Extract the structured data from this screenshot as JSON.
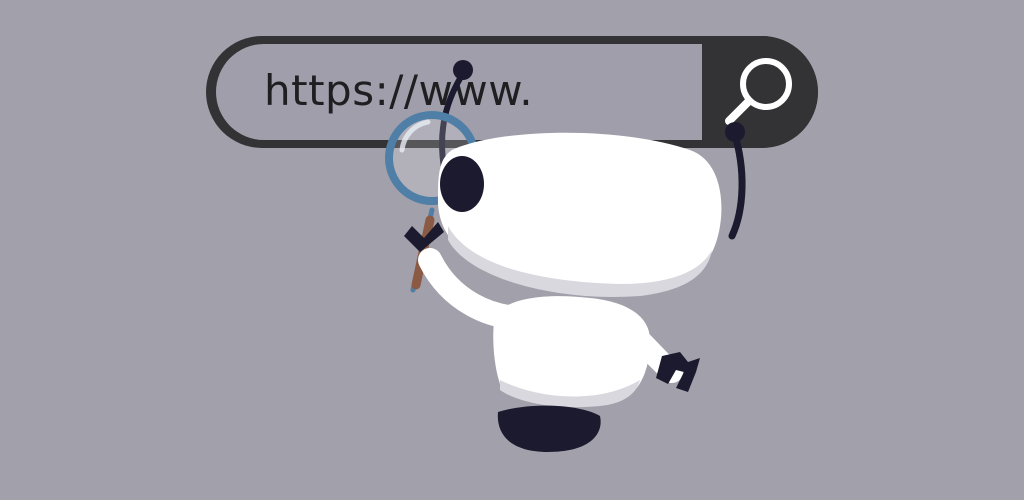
{
  "search": {
    "url_text": "https://www.",
    "button_icon": "search-icon"
  },
  "illustration": {
    "character": "robot",
    "held_item": "magnifying-glass-icon"
  },
  "colors": {
    "background": "#a2a0aa",
    "bar": "#333336",
    "robot_body": "#ffffff",
    "robot_dark": "#1b1a2e",
    "lens_rim": "#4f7fa6"
  }
}
